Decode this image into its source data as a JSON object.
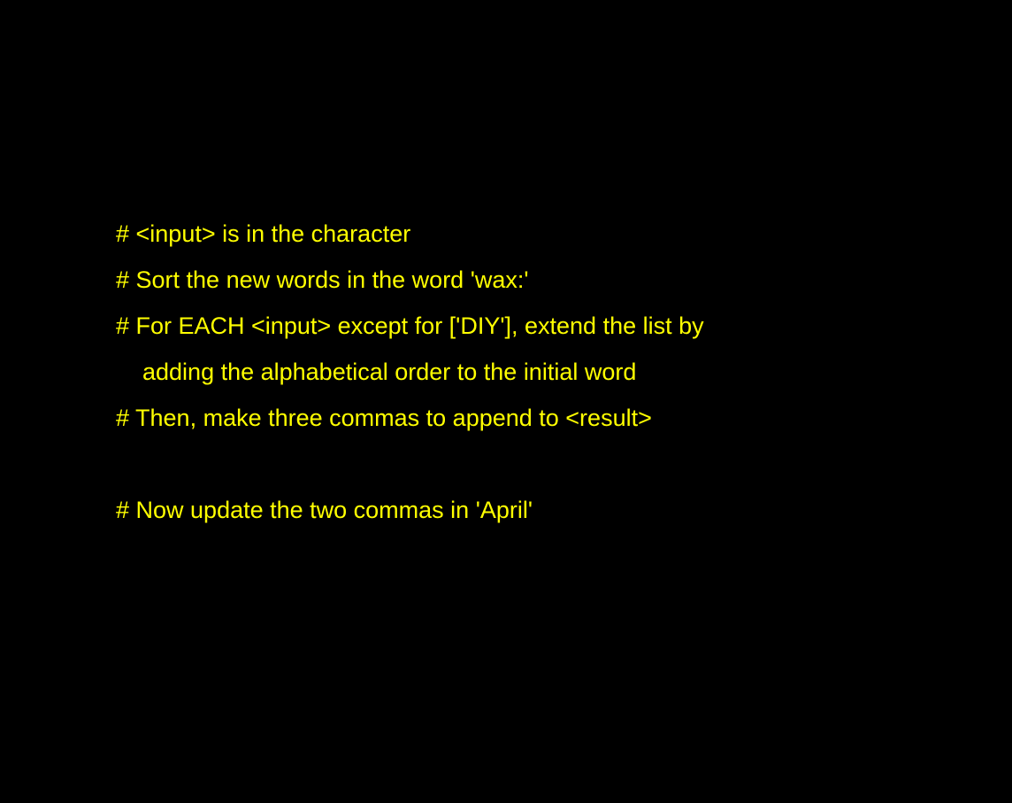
{
  "colors": {
    "background": "#000000",
    "text": "#ffff00"
  },
  "lines": [
    "# <input> is in the character",
    "# Sort the new words in the word 'wax:'",
    "# For EACH <input> except for ['DIY'], extend the list by",
    "adding the alphabetical order to the initial word",
    "# Then, make three commas to append to <result>",
    "",
    "# Now update the two commas in 'April'"
  ]
}
